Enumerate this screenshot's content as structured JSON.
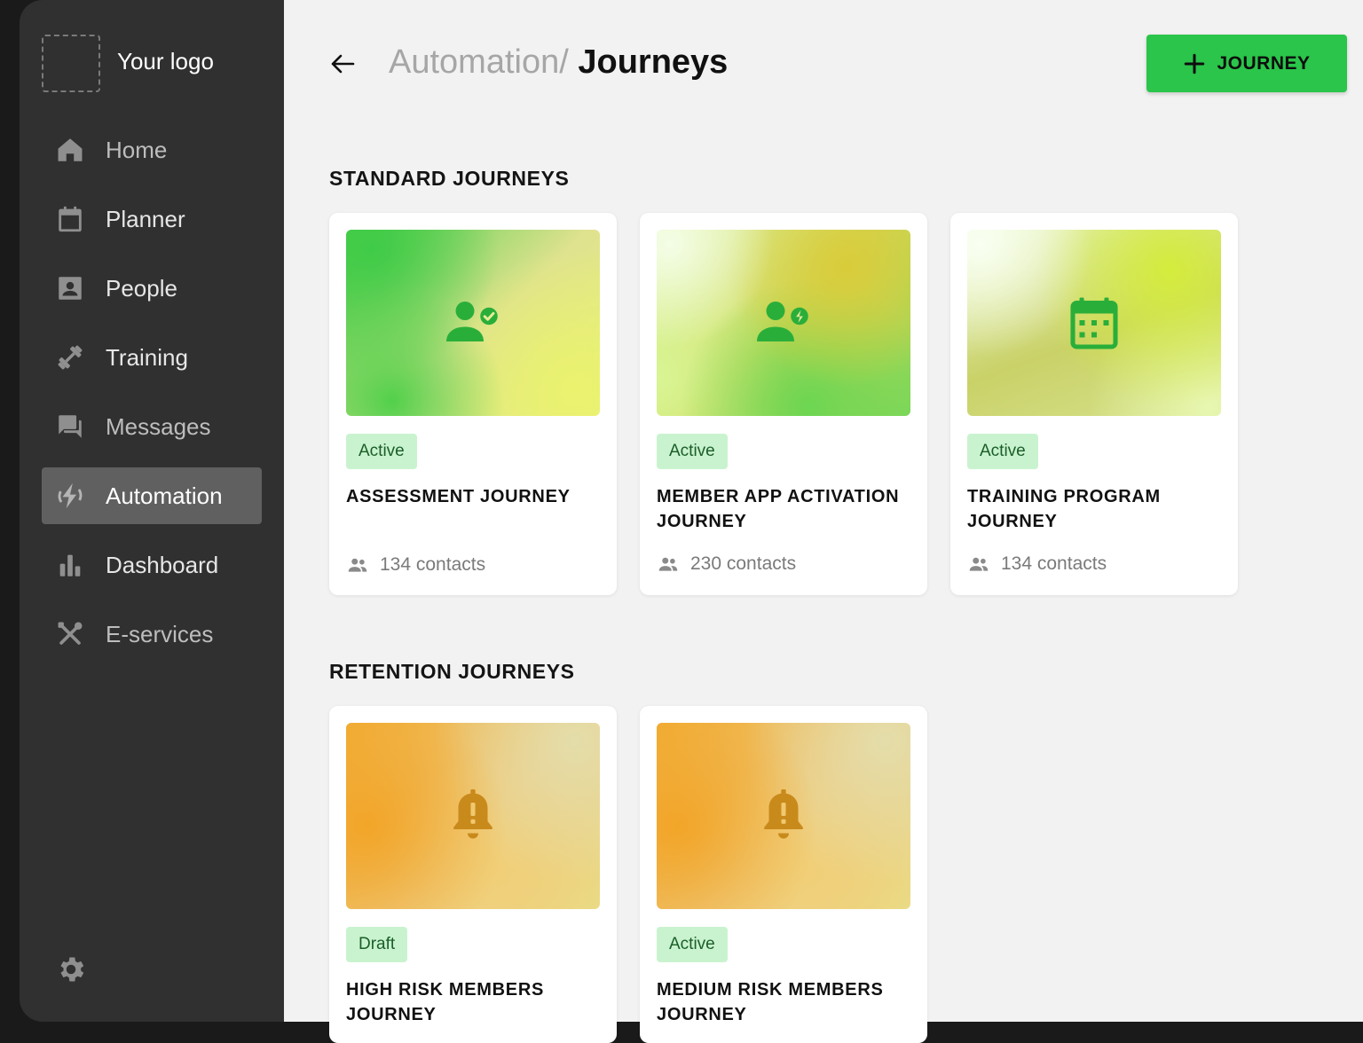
{
  "sidebar": {
    "logo_text": "Your logo",
    "items": [
      {
        "label": "Home",
        "icon": "home-icon"
      },
      {
        "label": "Planner",
        "icon": "calendar-icon"
      },
      {
        "label": "People",
        "icon": "contact-card-icon"
      },
      {
        "label": "Training",
        "icon": "dumbbell-icon"
      },
      {
        "label": "Messages",
        "icon": "chat-icon"
      },
      {
        "label": "Automation",
        "icon": "automation-icon",
        "active": true
      },
      {
        "label": "Dashboard",
        "icon": "bar-chart-icon"
      },
      {
        "label": "E-services",
        "icon": "tools-icon"
      }
    ],
    "settings_icon": "gear-icon"
  },
  "header": {
    "breadcrumb_parent": "Automation/",
    "breadcrumb_current": "Journeys",
    "add_button_label": "JOURNEY"
  },
  "sections": [
    {
      "title": "STANDARD JOURNEYS",
      "cards": [
        {
          "status": "Active",
          "title": "ASSESSMENT JOURNEY",
          "contacts": "134 contacts",
          "icon": "person-check-icon"
        },
        {
          "status": "Active",
          "title": "MEMBER APP ACTIVATION JOURNEY",
          "contacts": "230 contacts",
          "icon": "person-bolt-icon"
        },
        {
          "status": "Active",
          "title": "TRAINING PROGRAM JOURNEY",
          "contacts": "134 contacts",
          "icon": "calendar-icon"
        }
      ]
    },
    {
      "title": "RETENTION JOURNEYS",
      "cards": [
        {
          "status": "Draft",
          "title": "HIGH RISK MEMBERS JOURNEY",
          "icon": "bell-alert-icon"
        },
        {
          "status": "Active",
          "title": "MEDIUM RISK MEMBERS JOURNEY",
          "icon": "bell-alert-icon"
        }
      ]
    }
  ],
  "colors": {
    "accent_green": "#2ac54a",
    "badge_bg": "#c9f3cf",
    "sidebar_bg": "#303030",
    "main_bg": "#f2f2f2",
    "standard_icon": "#2aae3a",
    "retention_icon": "#c98a1c"
  }
}
